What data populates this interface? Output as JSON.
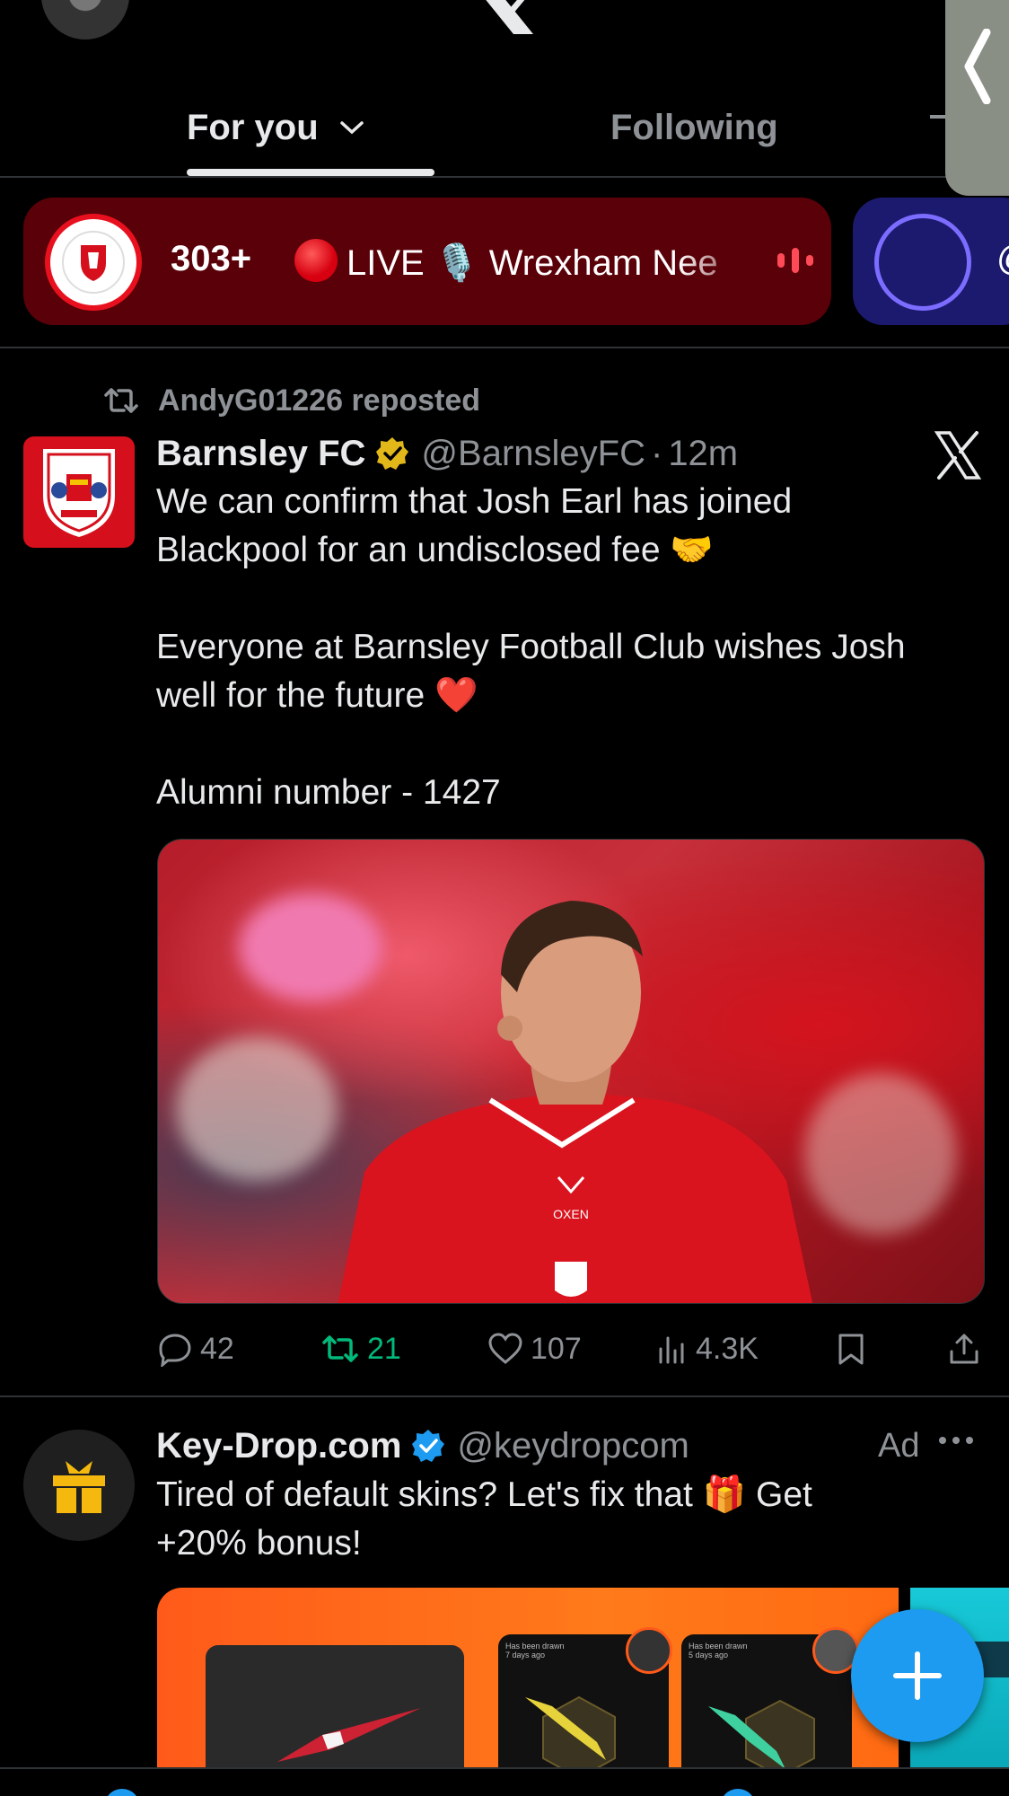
{
  "colors": {
    "background": "#000000",
    "text": "#e7e9ea",
    "muted": "#8e9296",
    "accent": "#1d9bf0",
    "repost_green": "#00ba7c",
    "live_red": "#e8101e"
  },
  "header": {
    "tabs": [
      {
        "label": "For you",
        "active": true
      },
      {
        "label": "Following",
        "active": false
      }
    ]
  },
  "spaces": [
    {
      "listeners": "303+",
      "title": "LIVE 🎙️ Wrexham Nee",
      "icon": "live-red-dot-icon"
    }
  ],
  "feed": {
    "tweet1": {
      "repost_by": "AndyG01226 reposted",
      "name": "Barnsley FC",
      "handle": "@BarnsleyFC",
      "separator": "·",
      "time": "12m",
      "text_lines": [
        "We can confirm that Josh Earl has joined",
        "Blackpool for an undisclosed fee 🤝",
        "",
        "Everyone at Barnsley Football Club wishes Josh",
        "well for the future ❤️",
        "",
        "Alumni number - 1427"
      ],
      "stats": {
        "replies": "42",
        "reposts": "21",
        "likes": "107",
        "views": "4.3K"
      }
    },
    "tweet2": {
      "name": "Key-Drop.com",
      "handle": "@keydropcom",
      "ad_label": "Ad",
      "text_lines": [
        "Tired of default skins? Let's fix that 🎁 Get",
        "+20% bonus!"
      ],
      "card_captions": [
        "Has been drawn",
        "7 days ago",
        "Has been drawn",
        "5 days ago"
      ]
    }
  }
}
